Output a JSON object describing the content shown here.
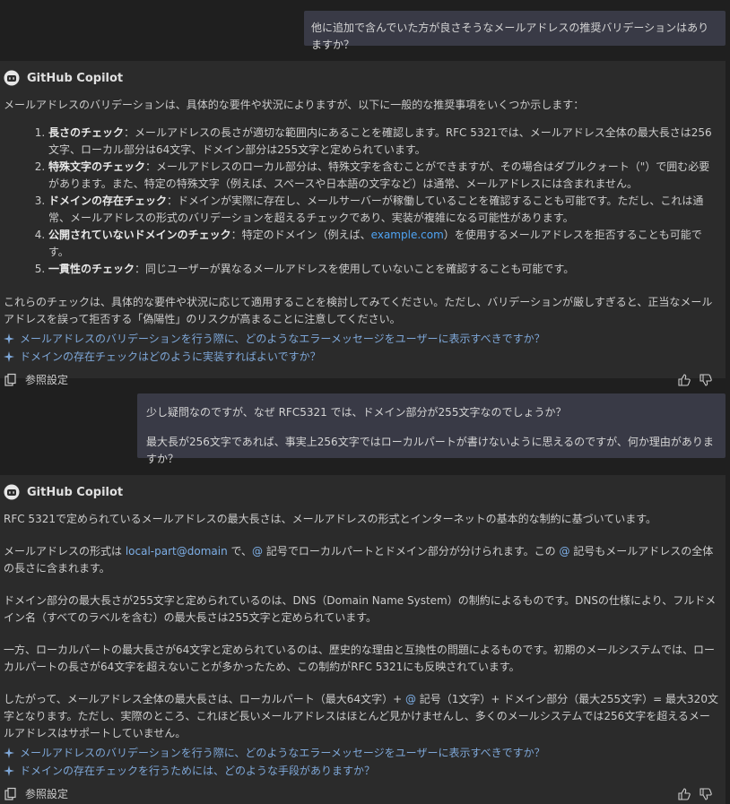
{
  "user1": "他に追加で含んでいた方が良さそうなメールアドレスの推奨バリデーションはありますか？",
  "bot_name": "GitHub Copilot",
  "answer1": {
    "intro": "メールアドレスのバリデーションは、具体的な要件や状況によりますが、以下に一般的な推奨事項をいくつか示します：",
    "items": [
      {
        "num": "1.",
        "title": "長さのチェック",
        "text": "：メールアドレスの長さが適切な範囲内にあることを確認します。RFC 5321では、メールアドレス全体の最大長さは256文字、ローカル部分は64文字、ドメイン部分は255文字と定められています。"
      },
      {
        "num": "2.",
        "title": "特殊文字のチェック",
        "text": "：メールアドレスのローカル部分は、特殊文字を含むことができますが、その場合はダブルクォート（\"）で囲む必要があります。また、特定の特殊文字（例えば、スペースや日本語の文字など）は通常、メールアドレスには含まれません。"
      },
      {
        "num": "3.",
        "title": "ドメインの存在チェック",
        "text": "：ドメインが実際に存在し、メールサーバーが稼働していることを確認することも可能です。ただし、これは通常、メールアドレスの形式のバリデーションを超えるチェックであり、実装が複雑になる可能性があります。"
      },
      {
        "num": "4.",
        "title": "公開されていないドメインのチェック",
        "text_a": "：特定のドメイン（例えば、",
        "link": "example.com",
        "text_b": "）を使用するメールアドレスを拒否することも可能です。"
      },
      {
        "num": "5.",
        "title": "一貫性のチェック",
        "text": "：同じユーザーが異なるメールアドレスを使用していないことを確認することも可能です。"
      }
    ],
    "outro": "これらのチェックは、具体的な要件や状況に応じて適用することを検討してみてください。ただし、バリデーションが厳しすぎると、正当なメールアドレスを誤って拒否する「偽陽性」のリスクが高まることに注意してください。",
    "suggestions": [
      "メールアドレスのバリデーションを行う際に、どのようなエラーメッセージをユーザーに表示すべきですか？",
      "ドメインの存在チェックはどのように実装すればよいですか？"
    ],
    "ref_label": "参照設定"
  },
  "user2": {
    "line1": "少し疑問なのですが、なぜ RFC5321 では、ドメイン部分が255文字なのでしょうか？",
    "line2": "最大長が256文字であれば、事実上256文字ではローカルパートが書けないように思えるのですが、何か理由がありますか？"
  },
  "answer2": {
    "p1": "RFC 5321で定められているメールアドレスの最大長さは、メールアドレスの形式とインターネットの基本的な制約に基づいています。",
    "p2_a": "メールアドレスの形式は ",
    "p2_code": "local-part@domain",
    "p2_b": " で、",
    "p2_at": "@",
    "p2_c": " 記号でローカルパートとドメイン部分が分けられます。この ",
    "p2_at2": "@",
    "p2_d": " 記号もメールアドレスの全体の長さに含まれます。",
    "p3": "ドメイン部分の最大長さが255文字と定められているのは、DNS（Domain Name System）の制約によるものです。DNSの仕様により、フルドメイン名（すべてのラベルを含む）の最大長さは255文字と定められています。",
    "p4": "一方、ローカルパートの最大長さが64文字と定められているのは、歴史的な理由と互換性の問題によるものです。初期のメールシステムでは、ローカルパートの長さが64文字を超えないことが多かったため、この制約がRFC 5321にも反映されています。",
    "p5_a": "したがって、メールアドレス全体の最大長さは、ローカルパート（最大64文字）+ ",
    "p5_at": "@",
    "p5_b": " 記号（1文字）+ ドメイン部分（最大255文字）= 最大320文字となります。ただし、実際のところ、これほど長いメールアドレスはほとんど見かけませんし、多くのメールシステムでは256文字を超えるメールアドレスはサポートしていません。",
    "suggestions": [
      "メールアドレスのバリデーションを行う際に、どのようなエラーメッセージをユーザーに表示すべきですか？",
      "ドメインの存在チェックを行うためには、どのような手段がありますか？"
    ],
    "ref_label": "参照設定"
  }
}
